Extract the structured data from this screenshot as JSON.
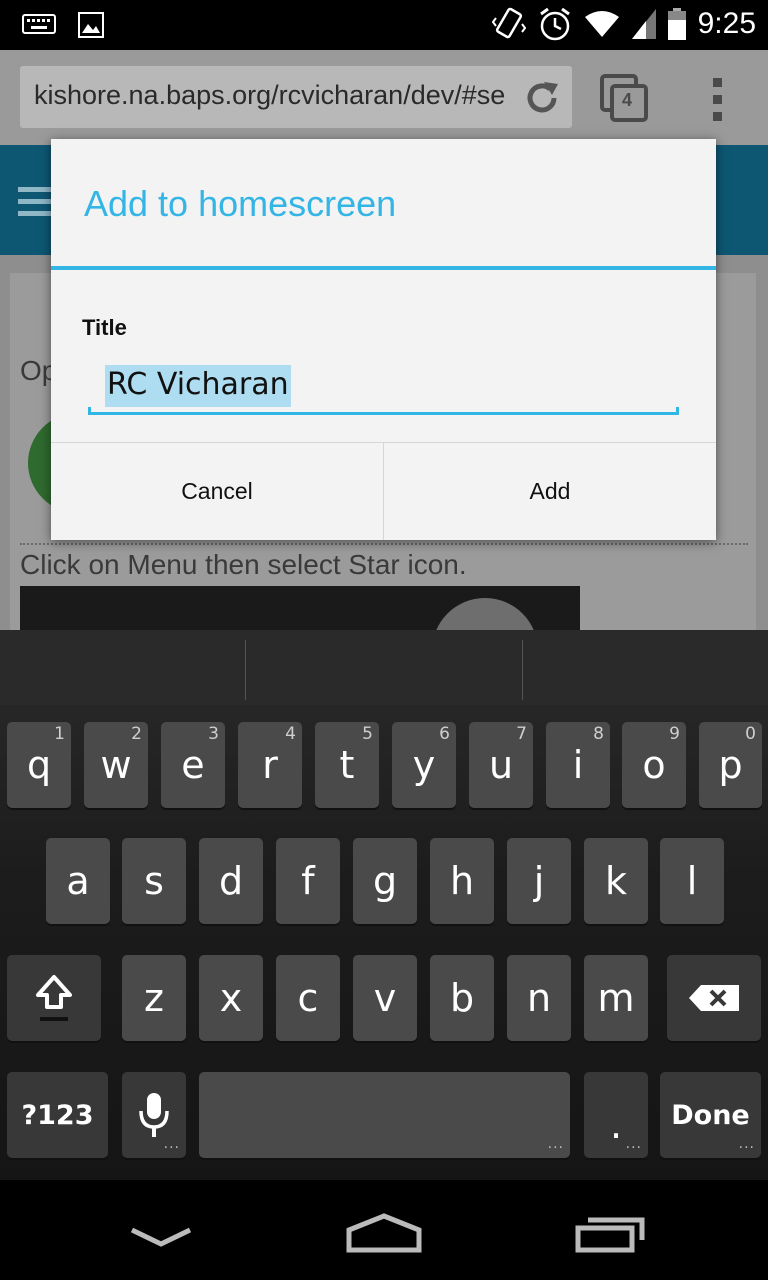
{
  "status_bar": {
    "time": "9:25",
    "icons": [
      "keyboard-icon",
      "image-icon",
      "vibrate-icon",
      "alarm-icon",
      "wifi-icon",
      "signal-icon",
      "battery-icon"
    ]
  },
  "browser": {
    "url": "kishore.na.baps.org/rcvicharan/dev/#se",
    "tab_count": "4"
  },
  "page_behind": {
    "partial_text": "Op",
    "instruction": "Click on Menu then select Star icon."
  },
  "dialog": {
    "title": "Add to homescreen",
    "field_label": "Title",
    "field_value": "RC Vicharan",
    "cancel_label": "Cancel",
    "add_label": "Add"
  },
  "keyboard": {
    "row1": [
      {
        "ch": "q",
        "hint": "1"
      },
      {
        "ch": "w",
        "hint": "2"
      },
      {
        "ch": "e",
        "hint": "3"
      },
      {
        "ch": "r",
        "hint": "4"
      },
      {
        "ch": "t",
        "hint": "5"
      },
      {
        "ch": "y",
        "hint": "6"
      },
      {
        "ch": "u",
        "hint": "7"
      },
      {
        "ch": "i",
        "hint": "8"
      },
      {
        "ch": "o",
        "hint": "9"
      },
      {
        "ch": "p",
        "hint": "0"
      }
    ],
    "row2": [
      "a",
      "s",
      "d",
      "f",
      "g",
      "h",
      "j",
      "k",
      "l"
    ],
    "row3": [
      "z",
      "x",
      "c",
      "v",
      "b",
      "n",
      "m"
    ],
    "symbols_label": "?123",
    "period_label": ".",
    "done_label": "Done"
  },
  "colors": {
    "accent": "#33b5e5",
    "key": "#4a4a4a",
    "header": "#0e5773"
  }
}
